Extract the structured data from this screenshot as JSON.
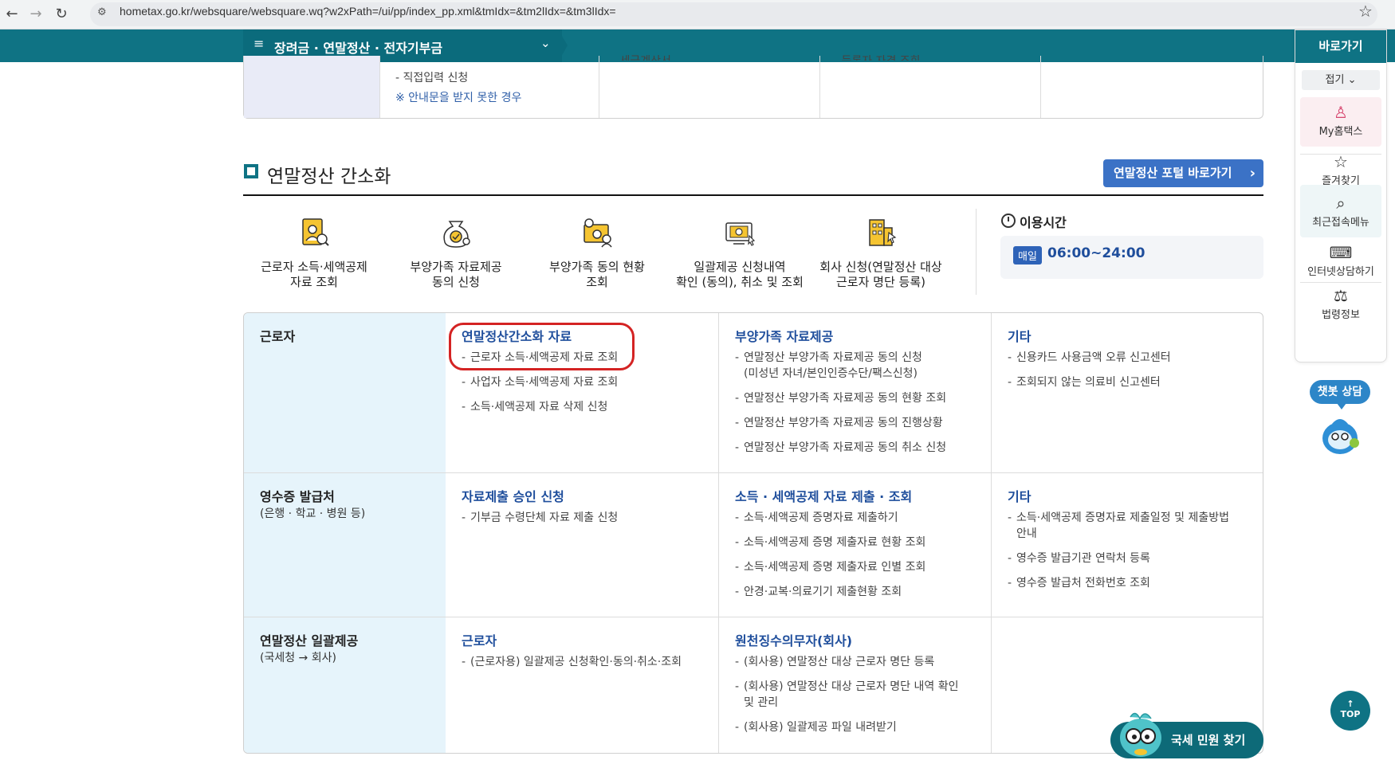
{
  "browser": {
    "url": "hometax.go.kr/websquare/websquare.wq?w2xPath=/ui/pp/index_pp.xml&tmIdx=&tm2lIdx=&tm3lIdx="
  },
  "menu": {
    "current": "장려금 · 연말정산 · 전자기부금"
  },
  "top_table": {
    "line1": "- 직접입력 신청",
    "line2": "※ 안내문을 받지 못한 경우",
    "cut_col2": "- 세금계산서",
    "cut_col3": "- 등록자 자격 조회"
  },
  "section": {
    "title": "연말정산 간소화",
    "portal_button": "연말정산 포털 바로가기"
  },
  "shortcuts": [
    {
      "label": "근로자 소득·세액공제\n자료 조회",
      "icon": "user-document-icon"
    },
    {
      "label": "부양가족 자료제공\n동의 신청",
      "icon": "money-bag-icon"
    },
    {
      "label": "부양가족 동의 현황\n조회",
      "icon": "family-consent-icon"
    },
    {
      "label": "일괄제공 신청내역\n확인 (동의), 취소 및 조회",
      "icon": "monitor-check-icon"
    },
    {
      "label": "회사 신청(연말정산 대상\n근로자 명단 등록)",
      "icon": "building-icon"
    }
  ],
  "hours": {
    "title": "이용시간",
    "badge": "매일",
    "value": "06:00~24:00"
  },
  "rows": [
    {
      "head": "근로자",
      "sub": "",
      "cols": [
        {
          "title": "연말정산간소화 자료",
          "items": [
            "근로자 소득·세액공제 자료 조회",
            "사업자 소득·세액공제 자료 조회",
            "소득·세액공제 자료 삭제 신청"
          ]
        },
        {
          "title": "부양가족 자료제공",
          "items": [
            "연말정산 부양가족 자료제공 동의 신청\n(미성년 자녀/본인인증수단/팩스신청)",
            "연말정산 부양가족 자료제공 동의 현황 조회",
            "연말정산 부양가족 자료제공 동의 진행상황",
            "연말정산 부양가족 자료제공 동의 취소 신청"
          ]
        },
        {
          "title": "기타",
          "items": [
            "신용카드 사용금액 오류 신고센터",
            "조회되지 않는 의료비 신고센터"
          ]
        }
      ]
    },
    {
      "head": "영수증 발급처",
      "sub": "(은행 · 학교 · 병원 등)",
      "cols": [
        {
          "title": "자료제출 승인 신청",
          "items": [
            "기부금 수령단체 자료 제출 신청"
          ]
        },
        {
          "title": "소득 · 세액공제 자료 제출 · 조회",
          "items": [
            "소득·세액공제 증명자료 제출하기",
            "소득·세액공제 증명 제출자료 현황 조회",
            "소득·세액공제 증명 제출자료 인별 조회",
            "안경·교복·의료기기 제출현황 조회"
          ]
        },
        {
          "title": "기타",
          "items": [
            "소득·세액공제 증명자료 제출일정 및 제출방법\n안내",
            "영수증 발급기관 연락처 등록",
            "영수증 발급처 전화번호 조회"
          ]
        }
      ]
    },
    {
      "head": "연말정산 일괄제공",
      "sub": "(국세청 → 회사)",
      "cols": [
        {
          "title": "근로자",
          "items": [
            "(근로자용) 일괄제공 신청확인·동의·취소·조회"
          ]
        },
        {
          "title": "원천징수의무자(회사)",
          "items": [
            "(회사용) 연말정산 대상 근로자 명단 등록",
            "(회사용) 연말정산 대상 근로자 명단 내역 확인\n및 관리",
            "(회사용) 일괄제공 파일 내려받기"
          ]
        },
        {
          "title": "",
          "items": []
        }
      ]
    }
  ],
  "quick": {
    "title": "바로가기",
    "fold": "접기",
    "items": [
      "My홈택스",
      "즐겨찾기",
      "최근접속메뉴",
      "인터넷상담하기",
      "법령정보"
    ]
  },
  "chatbot": "챗봇 상담",
  "top_button": "TOP",
  "minwon_button": "국세 민원 찾기",
  "colors": {
    "teal": "#0f7384",
    "link_blue": "#1f4e9c",
    "highlight": "#d42323"
  }
}
